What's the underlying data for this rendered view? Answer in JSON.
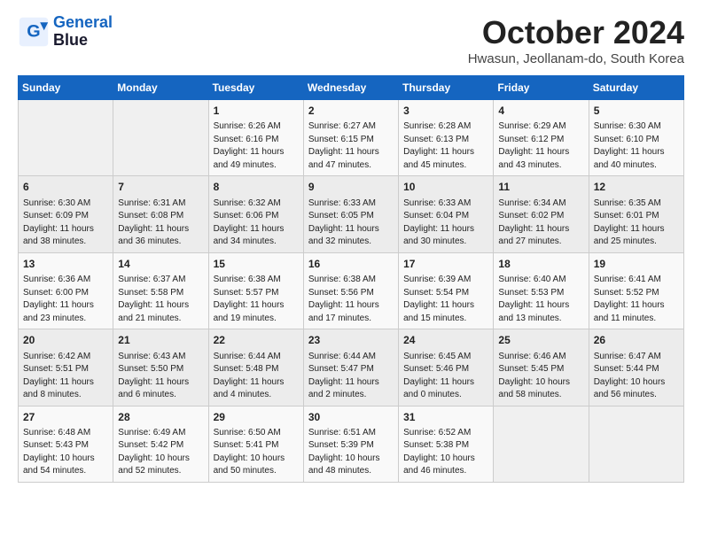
{
  "header": {
    "logo_line1": "General",
    "logo_line2": "Blue",
    "month_title": "October 2024",
    "subtitle": "Hwasun, Jeollanam-do, South Korea"
  },
  "weekdays": [
    "Sunday",
    "Monday",
    "Tuesday",
    "Wednesday",
    "Thursday",
    "Friday",
    "Saturday"
  ],
  "weeks": [
    [
      {
        "day": "",
        "info": ""
      },
      {
        "day": "",
        "info": ""
      },
      {
        "day": "1",
        "info": "Sunrise: 6:26 AM\nSunset: 6:16 PM\nDaylight: 11 hours and 49 minutes."
      },
      {
        "day": "2",
        "info": "Sunrise: 6:27 AM\nSunset: 6:15 PM\nDaylight: 11 hours and 47 minutes."
      },
      {
        "day": "3",
        "info": "Sunrise: 6:28 AM\nSunset: 6:13 PM\nDaylight: 11 hours and 45 minutes."
      },
      {
        "day": "4",
        "info": "Sunrise: 6:29 AM\nSunset: 6:12 PM\nDaylight: 11 hours and 43 minutes."
      },
      {
        "day": "5",
        "info": "Sunrise: 6:30 AM\nSunset: 6:10 PM\nDaylight: 11 hours and 40 minutes."
      }
    ],
    [
      {
        "day": "6",
        "info": "Sunrise: 6:30 AM\nSunset: 6:09 PM\nDaylight: 11 hours and 38 minutes."
      },
      {
        "day": "7",
        "info": "Sunrise: 6:31 AM\nSunset: 6:08 PM\nDaylight: 11 hours and 36 minutes."
      },
      {
        "day": "8",
        "info": "Sunrise: 6:32 AM\nSunset: 6:06 PM\nDaylight: 11 hours and 34 minutes."
      },
      {
        "day": "9",
        "info": "Sunrise: 6:33 AM\nSunset: 6:05 PM\nDaylight: 11 hours and 32 minutes."
      },
      {
        "day": "10",
        "info": "Sunrise: 6:33 AM\nSunset: 6:04 PM\nDaylight: 11 hours and 30 minutes."
      },
      {
        "day": "11",
        "info": "Sunrise: 6:34 AM\nSunset: 6:02 PM\nDaylight: 11 hours and 27 minutes."
      },
      {
        "day": "12",
        "info": "Sunrise: 6:35 AM\nSunset: 6:01 PM\nDaylight: 11 hours and 25 minutes."
      }
    ],
    [
      {
        "day": "13",
        "info": "Sunrise: 6:36 AM\nSunset: 6:00 PM\nDaylight: 11 hours and 23 minutes."
      },
      {
        "day": "14",
        "info": "Sunrise: 6:37 AM\nSunset: 5:58 PM\nDaylight: 11 hours and 21 minutes."
      },
      {
        "day": "15",
        "info": "Sunrise: 6:38 AM\nSunset: 5:57 PM\nDaylight: 11 hours and 19 minutes."
      },
      {
        "day": "16",
        "info": "Sunrise: 6:38 AM\nSunset: 5:56 PM\nDaylight: 11 hours and 17 minutes."
      },
      {
        "day": "17",
        "info": "Sunrise: 6:39 AM\nSunset: 5:54 PM\nDaylight: 11 hours and 15 minutes."
      },
      {
        "day": "18",
        "info": "Sunrise: 6:40 AM\nSunset: 5:53 PM\nDaylight: 11 hours and 13 minutes."
      },
      {
        "day": "19",
        "info": "Sunrise: 6:41 AM\nSunset: 5:52 PM\nDaylight: 11 hours and 11 minutes."
      }
    ],
    [
      {
        "day": "20",
        "info": "Sunrise: 6:42 AM\nSunset: 5:51 PM\nDaylight: 11 hours and 8 minutes."
      },
      {
        "day": "21",
        "info": "Sunrise: 6:43 AM\nSunset: 5:50 PM\nDaylight: 11 hours and 6 minutes."
      },
      {
        "day": "22",
        "info": "Sunrise: 6:44 AM\nSunset: 5:48 PM\nDaylight: 11 hours and 4 minutes."
      },
      {
        "day": "23",
        "info": "Sunrise: 6:44 AM\nSunset: 5:47 PM\nDaylight: 11 hours and 2 minutes."
      },
      {
        "day": "24",
        "info": "Sunrise: 6:45 AM\nSunset: 5:46 PM\nDaylight: 11 hours and 0 minutes."
      },
      {
        "day": "25",
        "info": "Sunrise: 6:46 AM\nSunset: 5:45 PM\nDaylight: 10 hours and 58 minutes."
      },
      {
        "day": "26",
        "info": "Sunrise: 6:47 AM\nSunset: 5:44 PM\nDaylight: 10 hours and 56 minutes."
      }
    ],
    [
      {
        "day": "27",
        "info": "Sunrise: 6:48 AM\nSunset: 5:43 PM\nDaylight: 10 hours and 54 minutes."
      },
      {
        "day": "28",
        "info": "Sunrise: 6:49 AM\nSunset: 5:42 PM\nDaylight: 10 hours and 52 minutes."
      },
      {
        "day": "29",
        "info": "Sunrise: 6:50 AM\nSunset: 5:41 PM\nDaylight: 10 hours and 50 minutes."
      },
      {
        "day": "30",
        "info": "Sunrise: 6:51 AM\nSunset: 5:39 PM\nDaylight: 10 hours and 48 minutes."
      },
      {
        "day": "31",
        "info": "Sunrise: 6:52 AM\nSunset: 5:38 PM\nDaylight: 10 hours and 46 minutes."
      },
      {
        "day": "",
        "info": ""
      },
      {
        "day": "",
        "info": ""
      }
    ]
  ]
}
